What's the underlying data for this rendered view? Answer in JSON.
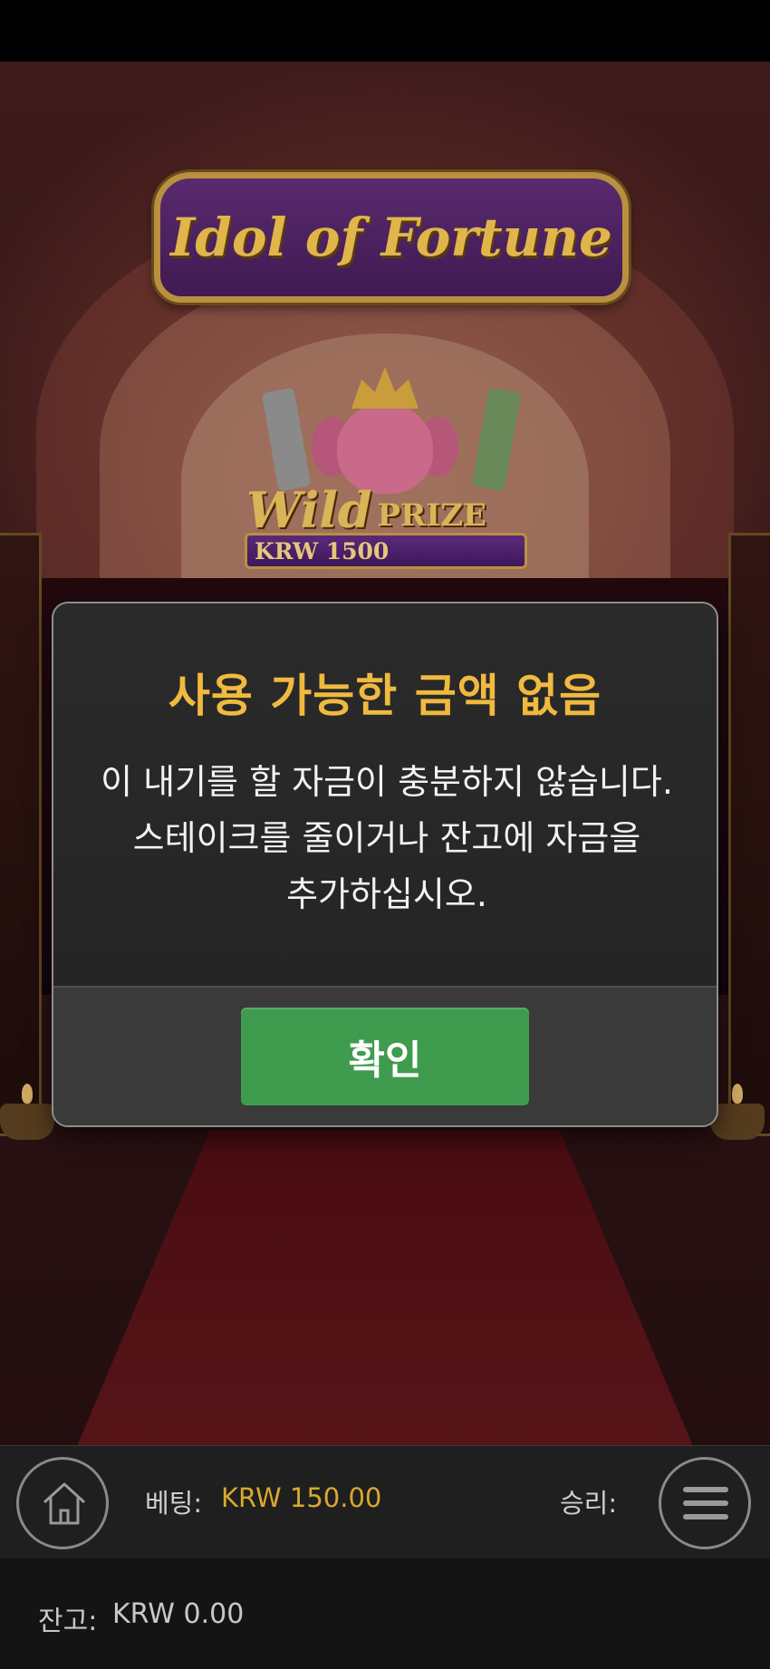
{
  "game": {
    "logo_text": "Idol of Fortune",
    "wild_label": "Wild",
    "prize_label": "PRIZE",
    "prize_amount": "KRW 1500"
  },
  "dialog": {
    "title": "사용 가능한 금액 없음",
    "message": "이 내기를 할 자금이 충분하지 않습니다. 스테이크를 줄이거나 잔고에 자금을 추가하십시오.",
    "confirm_label": "확인"
  },
  "bottom_bar": {
    "bet_label": "베팅:",
    "bet_value": "KRW 150.00",
    "win_label": "승리:",
    "balance_label": "잔고:",
    "balance_value": "KRW 0.00"
  },
  "colors": {
    "title_accent": "#f0b93f",
    "confirm_button": "#3f9c4e",
    "bet_value": "#d9a830"
  },
  "icons": {
    "home": "home-icon",
    "menu": "hamburger-menu-icon"
  }
}
